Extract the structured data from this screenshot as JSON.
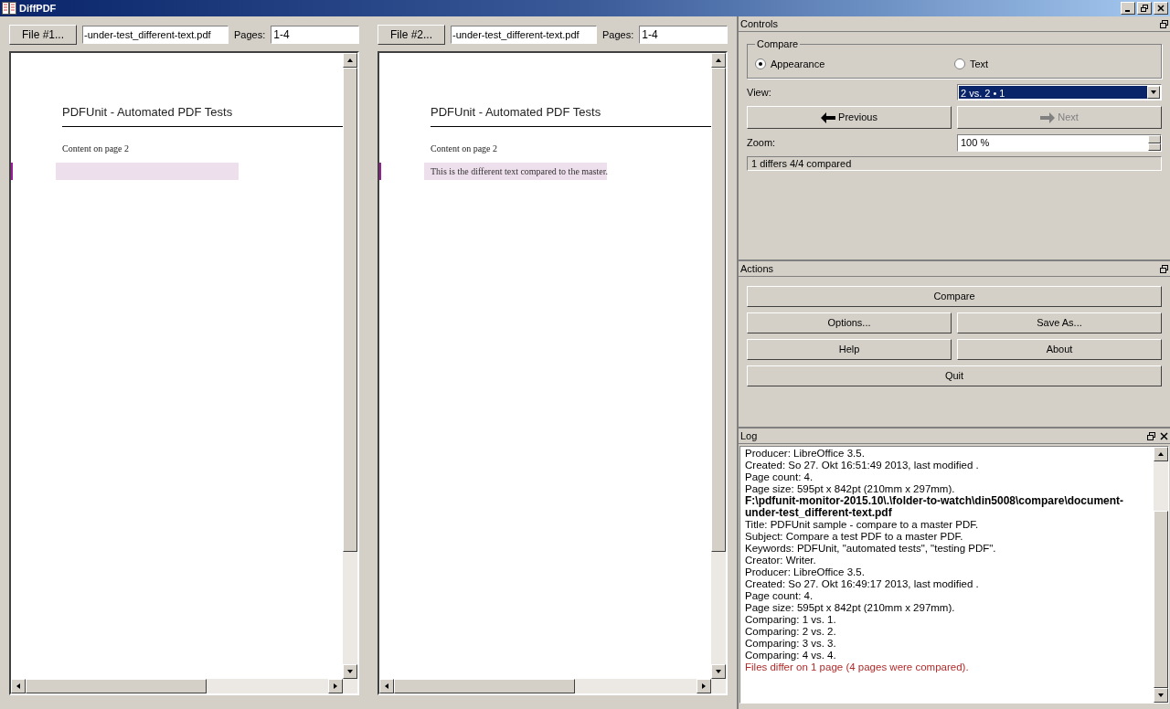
{
  "window": {
    "title": "DiffPDF"
  },
  "panes": [
    {
      "file_button": "File #1...",
      "file": "-under-test_different-text.pdf",
      "pages_label": "Pages:",
      "pages": "1-4",
      "page": {
        "header": "PDFUnit - Automated PDF Tests",
        "lines": [
          "Content on page 2"
        ],
        "difference_marked": true
      }
    },
    {
      "file_button": "File #2...",
      "file": "-under-test_different-text.pdf",
      "pages_label": "Pages:",
      "pages": "1-4",
      "page": {
        "header": "PDFUnit - Automated PDF Tests",
        "lines": [
          "Content on page 2"
        ],
        "difference_marked": true,
        "difference_text": "This is the different text compared to the master."
      }
    }
  ],
  "controls": {
    "title": "Controls",
    "compare_group": "Compare",
    "compare_modes": [
      {
        "label": "Appearance",
        "selected": true
      },
      {
        "label": "Text",
        "selected": false
      }
    ],
    "view_label": "View:",
    "view": "2 vs. 2 • 1",
    "previous": {
      "label": "Previous",
      "disabled": false
    },
    "next": {
      "label": "Next",
      "disabled": true
    },
    "zoom_label": "Zoom:",
    "zoom": "100 %",
    "status": "1 differs 4/4 compared"
  },
  "actions": {
    "title": "Actions",
    "rows": [
      [
        "Compare"
      ],
      [
        "Options...",
        "Save As..."
      ],
      [
        "Help",
        "About"
      ],
      [
        "Quit"
      ]
    ]
  },
  "log": {
    "title": "Log",
    "lines": [
      {
        "kind": "normal",
        "text": "Producer: LibreOffice 3.5."
      },
      {
        "kind": "normal",
        "text": "Created: So 27. Okt 16:51:49 2013, last modified ."
      },
      {
        "kind": "normal",
        "text": "Page count: 4."
      },
      {
        "kind": "normal",
        "text": "Page size: 595pt x 842pt (210mm x 297mm)."
      },
      {
        "kind": "bold",
        "text": "F:\\pdfunit-monitor-2015.10\\.\\folder-to-watch\\din5008\\compare\\document-under-test_different-text.pdf"
      },
      {
        "kind": "normal",
        "text": "Title: PDFUnit sample - compare to a master PDF."
      },
      {
        "kind": "normal",
        "text": "Subject: Compare a test PDF to a master PDF."
      },
      {
        "kind": "normal",
        "text": "Keywords: PDFUnit, \"automated tests\", \"testing PDF\"."
      },
      {
        "kind": "normal",
        "text": "Creator: Writer."
      },
      {
        "kind": "normal",
        "text": "Producer: LibreOffice 3.5."
      },
      {
        "kind": "normal",
        "text": "Created: So 27. Okt 16:49:17 2013, last modified ."
      },
      {
        "kind": "normal",
        "text": "Page count: 4."
      },
      {
        "kind": "normal",
        "text": "Page size: 595pt x 842pt (210mm x 297mm)."
      },
      {
        "kind": "normal",
        "text": "Comparing: 1 vs. 1."
      },
      {
        "kind": "normal",
        "text": "Comparing: 2 vs. 2."
      },
      {
        "kind": "normal",
        "text": "Comparing: 3 vs. 3."
      },
      {
        "kind": "normal",
        "text": "Comparing: 4 vs. 4."
      },
      {
        "kind": "error",
        "text": "Files differ on 1 page (4 pages were compared)."
      }
    ]
  }
}
